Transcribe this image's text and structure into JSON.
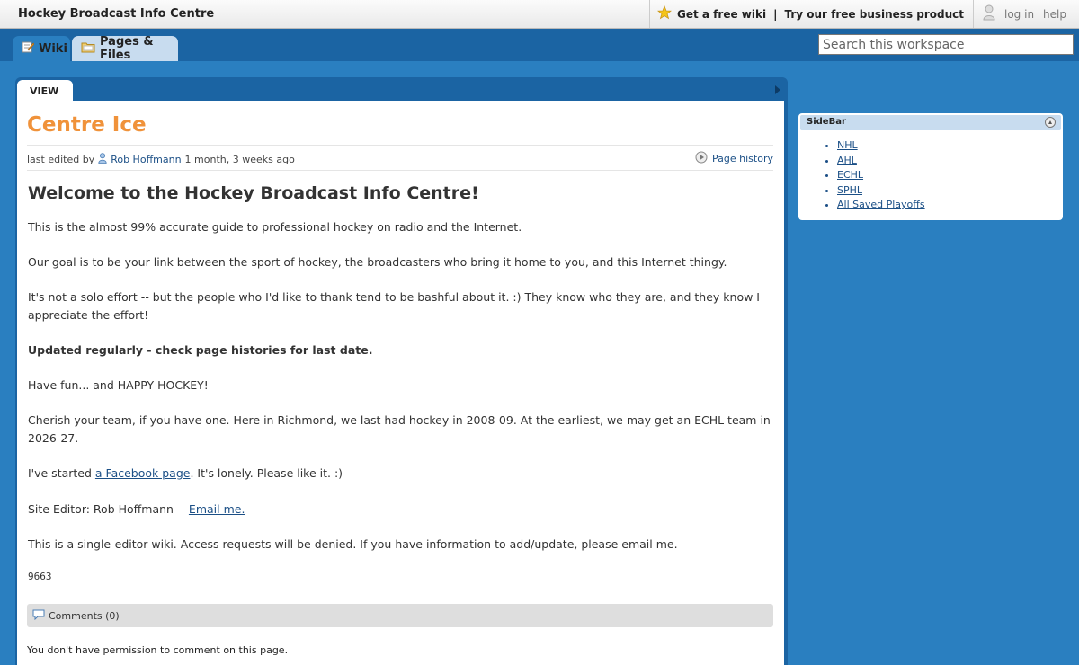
{
  "app": {
    "site_title": "Hockey Broadcast Info Centre"
  },
  "topbar": {
    "free_wiki": "Get a free wiki",
    "separator": "|",
    "business": "Try our free business product",
    "log_in": "log in",
    "help": "help"
  },
  "tabs": {
    "wiki": "Wiki",
    "pages_files": "Pages & Files"
  },
  "search": {
    "placeholder": "Search this workspace"
  },
  "page": {
    "view_tab": "VIEW",
    "title": "Centre Ice",
    "meta": {
      "prefix": "last edited by",
      "user": "Rob Hoffmann",
      "when": "1 month, 3 weeks ago",
      "history": "Page history"
    },
    "heading": "Welcome to the Hockey Broadcast Info Centre!",
    "p1": "This is the almost 99% accurate guide to professional hockey on radio and the Internet.",
    "p2": "Our goal is to be your link between the sport of hockey, the broadcasters who bring it home to you, and this Internet thingy.",
    "p3": "It's not a solo effort -- but the people who I'd like to thank tend to be bashful about it. :) They know who they are, and they know I appreciate the effort!",
    "p4": "Updated regularly - check page histories for last date.",
    "p5": "Have fun... and HAPPY HOCKEY!",
    "p6": "Cherish your team, if you have one.  Here in Richmond, we last had hockey in 2008-09.  At the earliest, we may get an ECHL team in 2026-27.",
    "p7_before": "I've started ",
    "p7_link": "a Facebook page",
    "p7_after": ".  It's lonely.  Please like it. :)",
    "editor_text": "Site Editor: Rob Hoffmann -- ",
    "editor_link": "Email me.",
    "single_editor": "This is a single-editor wiki.  Access requests will be denied.  If you have information to add/update, please email me.",
    "counter": "9663",
    "comments": "Comments (0)",
    "no_permission": "You don't have permission to comment on this page."
  },
  "sidebar": {
    "title": "SideBar",
    "items": [
      {
        "label": "NHL"
      },
      {
        "label": "AHL"
      },
      {
        "label": "ECHL"
      },
      {
        "label": "SPHL"
      },
      {
        "label": "All Saved Playoffs"
      }
    ]
  }
}
